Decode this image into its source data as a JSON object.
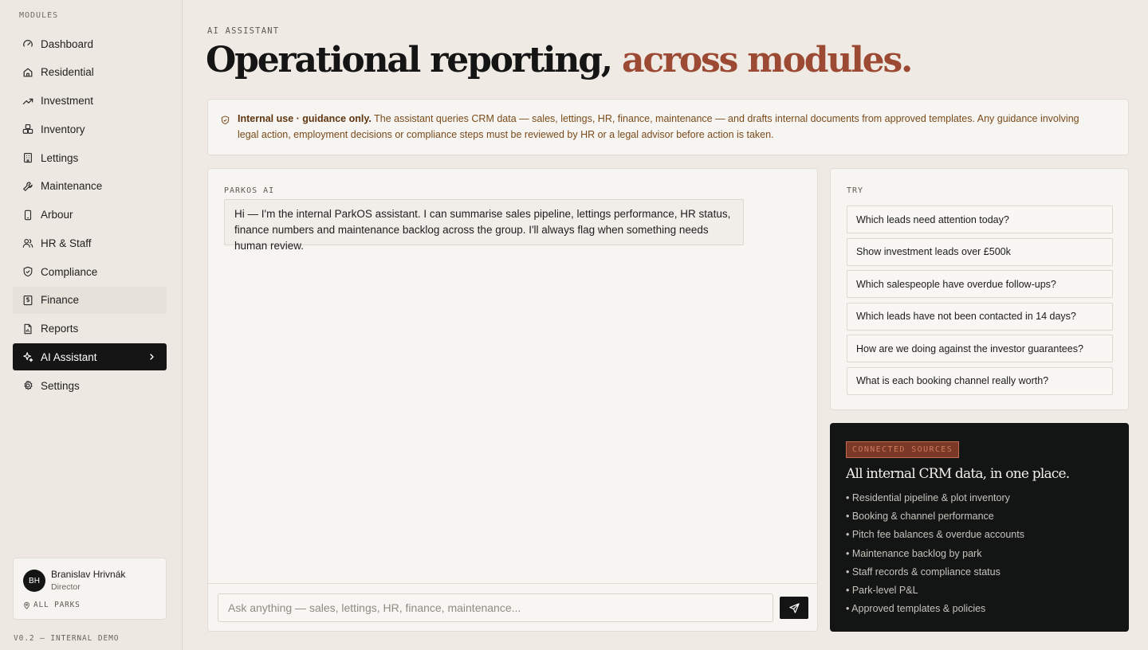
{
  "sidebar": {
    "heading": "MODULES",
    "items": [
      {
        "label": "Dashboard",
        "icon": "gauge-icon"
      },
      {
        "label": "Residential",
        "icon": "home-icon"
      },
      {
        "label": "Investment",
        "icon": "trending-up-icon"
      },
      {
        "label": "Inventory",
        "icon": "boxes-icon"
      },
      {
        "label": "Lettings",
        "icon": "building-icon"
      },
      {
        "label": "Maintenance",
        "icon": "wrench-icon"
      },
      {
        "label": "Arbour",
        "icon": "phone-icon"
      },
      {
        "label": "HR & Staff",
        "icon": "users-icon"
      },
      {
        "label": "Compliance",
        "icon": "shield-check-icon"
      },
      {
        "label": "Finance",
        "icon": "receipt-icon"
      },
      {
        "label": "Reports",
        "icon": "file-chart-icon"
      },
      {
        "label": "AI Assistant",
        "icon": "sparkles-icon"
      },
      {
        "label": "Settings",
        "icon": "gear-icon"
      }
    ],
    "active_item": "AI Assistant",
    "hover_item": "Finance",
    "user": {
      "initials": "BH",
      "name": "Branislav Hrivnák",
      "role": "Director",
      "scope": "ALL PARKS"
    },
    "version": "V0.2 — INTERNAL DEMO"
  },
  "header": {
    "eyebrow": "AI ASSISTANT",
    "title_main": "Operational reporting,",
    "title_accent": "across modules."
  },
  "notice": {
    "bold": "Internal use · guidance only.",
    "text": "The assistant queries CRM data — sales, lettings, HR, finance, maintenance — and drafts internal documents from approved templates. Any guidance involving legal action, employment decisions or compliance steps must be reviewed by HR or a legal advisor before action is taken."
  },
  "chat": {
    "sender_label": "PARKOS AI",
    "message": "Hi — I'm the internal ParkOS assistant. I can summarise sales pipeline, lettings performance, HR status, finance numbers and maintenance backlog across the group. I'll always flag when something needs human review.",
    "input_placeholder": "Ask anything — sales, lettings, HR, finance, maintenance..."
  },
  "try": {
    "label": "TRY",
    "suggestions": [
      "Which leads need attention today?",
      "Show investment leads over £500k",
      "Which salespeople have overdue follow-ups?",
      "Which leads have not been contacted in 14 days?",
      "How are we doing against the investor guarantees?",
      "What is each booking channel really worth?"
    ]
  },
  "sources": {
    "badge": "CONNECTED SOURCES",
    "title": "All internal CRM data, in one place.",
    "items": [
      "• Residential pipeline & plot inventory",
      "• Booking & channel performance",
      "• Pitch fee balances & overdue accounts",
      "• Maintenance backlog by park",
      "• Staff records & compliance status",
      "• Park-level P&L",
      "• Approved templates & policies"
    ]
  },
  "colors": {
    "accent": "#9c4a34",
    "active_nav": "#151515",
    "background": "#efebe4",
    "notice_text": "#7a4a1b"
  }
}
